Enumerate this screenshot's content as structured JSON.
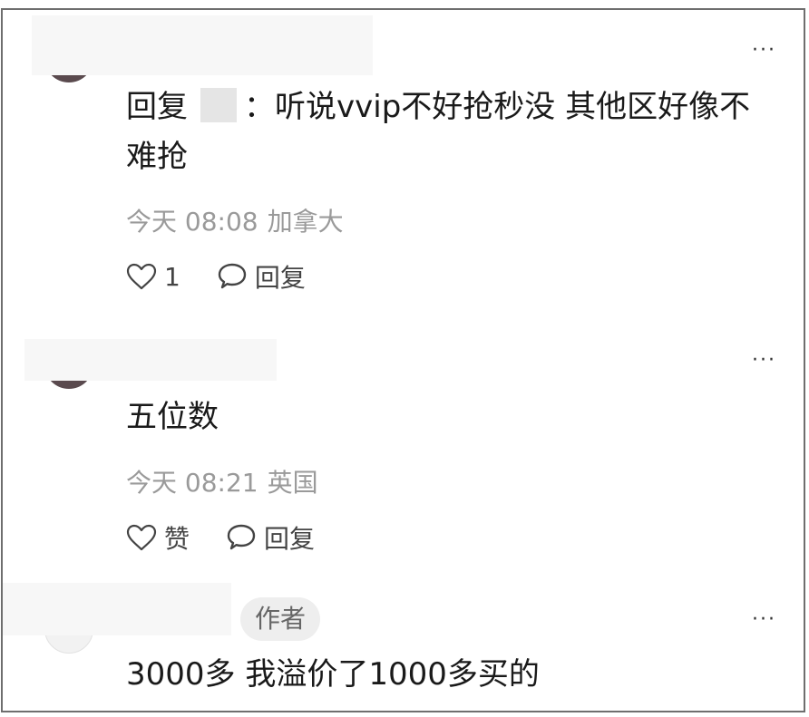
{
  "comments": [
    {
      "reply_prefix": "回复",
      "text": "：听说vvip不好抢秒没 其他区好像不难抢",
      "time": "今天 08:08",
      "location": "加拿大",
      "like_label": "1",
      "reply_label": "回复",
      "more_label": "···"
    },
    {
      "text": "五位数",
      "time": "今天 08:21",
      "location": "英国",
      "like_label": "赞",
      "reply_label": "回复",
      "more_label": "···"
    },
    {
      "badge": "作者",
      "text": "3000多 我溢价了1000多买的",
      "more_label": "···"
    }
  ],
  "icons": {
    "like": "heart-outline-icon",
    "reply": "speech-bubble-icon",
    "more": "more-dots-icon"
  },
  "colors": {
    "border": "#6e6e6e",
    "meta_text": "#9a9a9a",
    "badge_bg": "#eeeeee"
  }
}
